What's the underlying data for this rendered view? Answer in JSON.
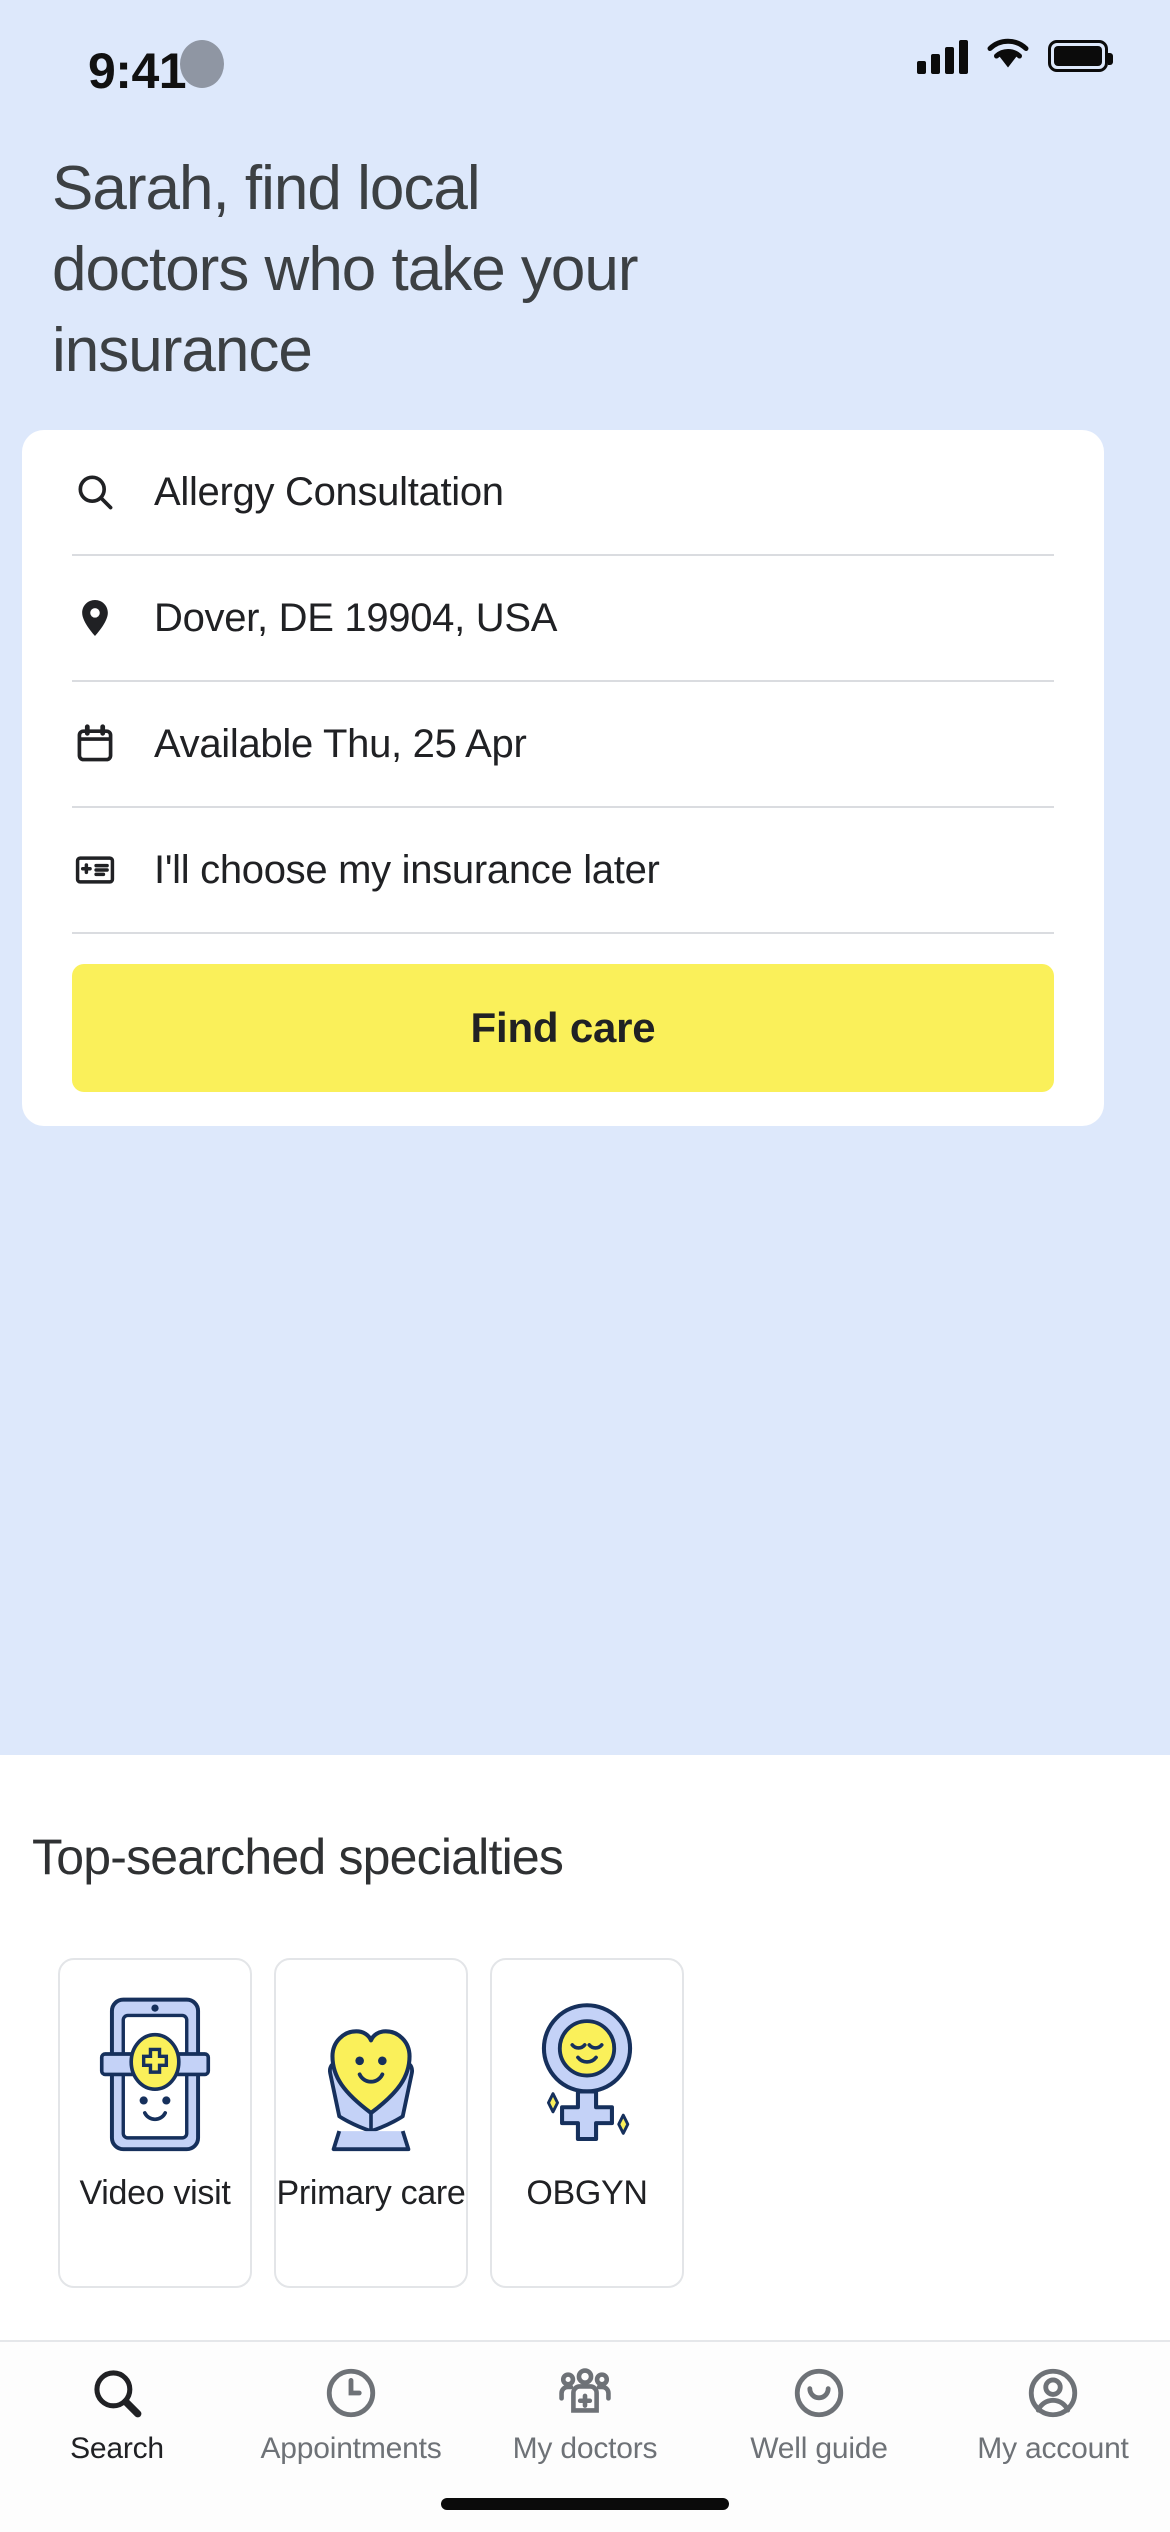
{
  "status_bar": {
    "time": "9:41",
    "signal_icon": "cellular-signal-icon",
    "wifi_icon": "wifi-icon",
    "battery_icon": "battery-icon"
  },
  "header": {
    "title": "Sarah, find local doctors who take your insurance",
    "background_color": "#DDE8FB"
  },
  "search_card": {
    "rows": [
      {
        "icon": "search-icon",
        "value": "Allergy Consultation"
      },
      {
        "icon": "location-pin-icon",
        "value": "Dover, DE 19904, USA"
      },
      {
        "icon": "calendar-icon",
        "value": "Available Thu, 25 Apr"
      },
      {
        "icon": "insurance-card-icon",
        "value": "I'll choose my insurance later"
      }
    ],
    "submit_label": "Find care",
    "submit_color": "#FAF05A"
  },
  "specialties": {
    "title": "Top-searched specialties",
    "cards": [
      {
        "label": "Video visit",
        "art": "tablet-with-medical-cross-smiley-illustration"
      },
      {
        "label": "Primary care",
        "art": "hands-holding-heart-illustration"
      },
      {
        "label": "OBGYN",
        "art": "female-symbol-smiley-illustration"
      }
    ],
    "art_colors": {
      "blue_fill": "#C4D2F7",
      "navy_stroke": "#16305C",
      "yellow_fill": "#FAF05A"
    }
  },
  "tabbar": {
    "items": [
      {
        "label": "Search",
        "icon": "search-icon",
        "active": true
      },
      {
        "label": "Appointments",
        "icon": "clock-icon",
        "active": false
      },
      {
        "label": "My doctors",
        "icon": "people-plus-icon",
        "active": false
      },
      {
        "label": "Well guide",
        "icon": "smiley-circle-icon",
        "active": false
      },
      {
        "label": "My account",
        "icon": "account-circle-icon",
        "active": false
      }
    ]
  }
}
